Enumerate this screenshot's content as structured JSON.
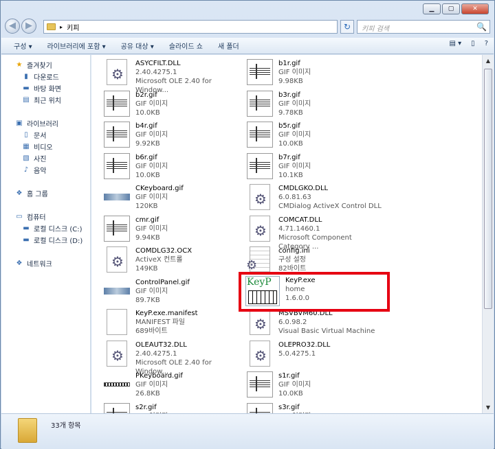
{
  "window": {
    "min": "▁",
    "max": "▢",
    "close": "✕"
  },
  "address": {
    "path": "키피",
    "search_placeholder": "키피 검색",
    "sep": "▸",
    "refresh_glyph": "↻",
    "search_glyph": "🔍"
  },
  "toolbar": {
    "items": [
      "구성 ▾",
      "라이브러리에 포함 ▾",
      "공유 대상 ▾",
      "슬라이드 쇼",
      "새 폴더"
    ],
    "right_icons": [
      "▤ ▾",
      "▯",
      "?"
    ]
  },
  "sidebar": [
    {
      "icon": "★",
      "label": "즐겨찾기",
      "name": "favorites",
      "indent": 0
    },
    {
      "icon": "▮",
      "label": "다운로드",
      "name": "downloads",
      "indent": 1
    },
    {
      "icon": "▬",
      "label": "바탕 화면",
      "name": "desktop",
      "indent": 1
    },
    {
      "icon": "▤",
      "label": "최근 위치",
      "name": "recent",
      "indent": 1
    },
    {
      "icon": "",
      "label": "",
      "name": "gap1",
      "indent": 0
    },
    {
      "icon": "▣",
      "label": "라이브러리",
      "name": "libraries",
      "indent": 0
    },
    {
      "icon": "▯",
      "label": "문서",
      "name": "documents",
      "indent": 1
    },
    {
      "icon": "▦",
      "label": "비디오",
      "name": "videos",
      "indent": 1
    },
    {
      "icon": "▧",
      "label": "사진",
      "name": "pictures",
      "indent": 1
    },
    {
      "icon": "♪",
      "label": "음악",
      "name": "music",
      "indent": 1
    },
    {
      "icon": "",
      "label": "",
      "name": "gap2",
      "indent": 0
    },
    {
      "icon": "❖",
      "label": "홈 그룹",
      "name": "homegroup",
      "indent": 0
    },
    {
      "icon": "",
      "label": "",
      "name": "gap3",
      "indent": 0
    },
    {
      "icon": "▭",
      "label": "컴퓨터",
      "name": "computer",
      "indent": 0
    },
    {
      "icon": "▬",
      "label": "로컬 디스크 (C:)",
      "name": "drive-c",
      "indent": 1
    },
    {
      "icon": "▬",
      "label": "로컬 디스크 (D:)",
      "name": "drive-d",
      "indent": 1
    },
    {
      "icon": "",
      "label": "",
      "name": "gap4",
      "indent": 0
    },
    {
      "icon": "❖",
      "label": "네트워크",
      "name": "network",
      "indent": 0
    }
  ],
  "files": [
    {
      "name": "ASYCFILT.DLL",
      "l2": "2.40.4275.1",
      "l3": "Microsoft OLE 2.40  for Window...",
      "type": "dll"
    },
    {
      "name": "b1r.gif",
      "l2": "GIF 이미지",
      "l3": "9.98KB",
      "type": "gif"
    },
    {
      "name": "b2r.gif",
      "l2": "GIF 이미지",
      "l3": "10.0KB",
      "type": "gif"
    },
    {
      "name": "b3r.gif",
      "l2": "GIF 이미지",
      "l3": "9.78KB",
      "type": "gif"
    },
    {
      "name": "b4r.gif",
      "l2": "GIF 이미지",
      "l3": "9.92KB",
      "type": "gif"
    },
    {
      "name": "b5r.gif",
      "l2": "GIF 이미지",
      "l3": "10.0KB",
      "type": "gif"
    },
    {
      "name": "b6r.gif",
      "l2": "GIF 이미지",
      "l3": "10.0KB",
      "type": "gif"
    },
    {
      "name": "b7r.gif",
      "l2": "GIF 이미지",
      "l3": "10.1KB",
      "type": "gif"
    },
    {
      "name": "CKeyboard.gif",
      "l2": "GIF 이미지",
      "l3": "120KB",
      "type": "banner"
    },
    {
      "name": "CMDLGKO.DLL",
      "l2": "6.0.81.63",
      "l3": "CMDialog ActiveX Control DLL",
      "type": "dll"
    },
    {
      "name": "cmr.gif",
      "l2": "GIF 이미지",
      "l3": "9.94KB",
      "type": "gif"
    },
    {
      "name": "COMCAT.DLL",
      "l2": "4.71.1460.1",
      "l3": "Microsoft Component Category ...",
      "type": "dll"
    },
    {
      "name": "COMDLG32.OCX",
      "l2": "ActiveX 컨트롤",
      "l3": "149KB",
      "type": "dll"
    },
    {
      "name": "config.ini",
      "l2": "구성 설정",
      "l3": "82바이트",
      "type": "ini"
    },
    {
      "name": "ControlPanel.gif",
      "l2": "GIF 이미지",
      "l3": "89.7KB",
      "type": "banner"
    },
    {
      "name": "KeyP.exe",
      "l2": "home",
      "l3": "1.6.0.0",
      "type": "keyp"
    },
    {
      "name": "KeyP.exe.manifest",
      "l2": "MANIFEST 파일",
      "l3": "689바이트",
      "type": "doc"
    },
    {
      "name": "MSVBVM60.DLL",
      "l2": "6.0.98.2",
      "l3": "Visual Basic Virtual Machine",
      "type": "dll"
    },
    {
      "name": "OLEAUT32.DLL",
      "l2": "2.40.4275.1",
      "l3": "Microsoft OLE 2.40  for Window...",
      "type": "dll"
    },
    {
      "name": "OLEPRO32.DLL",
      "l2": "5.0.4275.1",
      "l3": "",
      "type": "dll"
    },
    {
      "name": "PKeyboard.gif",
      "l2": "GIF 이미지",
      "l3": "26.8KB",
      "type": "pkb"
    },
    {
      "name": "s1r.gif",
      "l2": "GIF 이미지",
      "l3": "10.0KB",
      "type": "gif"
    },
    {
      "name": "s2r.gif",
      "l2": "GIF 이미지",
      "l3": "",
      "type": "gif"
    },
    {
      "name": "s3r.gif",
      "l2": "GIF 이미지",
      "l3": "",
      "type": "gif"
    }
  ],
  "status": {
    "count": "33개 항목"
  },
  "scrollbar": {
    "up": "▲",
    "down": "▼"
  },
  "highlight_color": "#e60012"
}
